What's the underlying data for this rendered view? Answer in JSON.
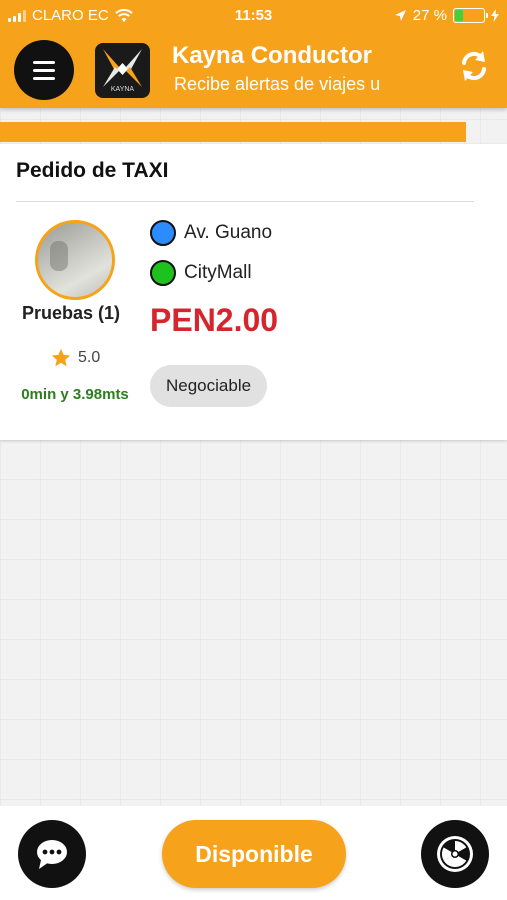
{
  "status_bar": {
    "carrier": "CLARO EC",
    "time": "11:53",
    "battery_text": "27 %",
    "battery_level": 0.27
  },
  "app_bar": {
    "title": "Kayna Conductor",
    "subtitle": "Recibe alertas de viajes u",
    "logo_text": "KAYNA"
  },
  "progress": {
    "value": 0.92
  },
  "order": {
    "title": "Pedido de TAXI",
    "driver_name": "Pruebas (1)",
    "rating": "5.0",
    "eta": "0min y 3.98mts",
    "origin": "Av. Guano",
    "destination": "CityMall",
    "price": "PEN2.00",
    "negotiable_label": "Negociable"
  },
  "bottom_bar": {
    "available_label": "Disponible"
  },
  "colors": {
    "accent": "#f7a21b",
    "price": "#d6252c",
    "eta": "#2e7d1e",
    "origin_dot": "#2a8cff",
    "destination_dot": "#1ec21e"
  }
}
